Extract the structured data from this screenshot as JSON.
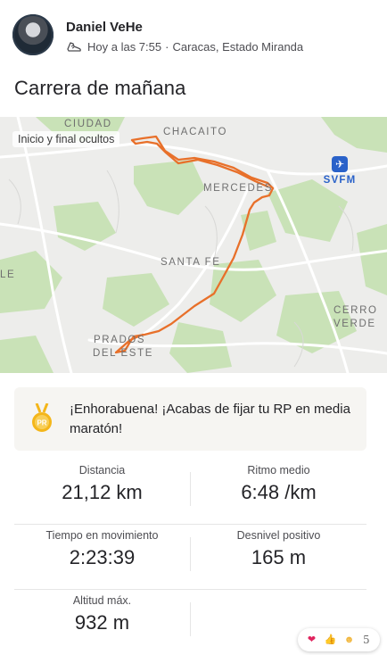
{
  "header": {
    "athlete_name": "Daniel VeHe",
    "timestamp": "Hoy a las 7:55",
    "separator": "·",
    "location": "Caracas, Estado Miranda",
    "activity_icon": "running-shoe-icon"
  },
  "activity": {
    "title": "Carrera de mañana"
  },
  "map": {
    "privacy_note": "Inicio y final ocultos",
    "labels": {
      "ciudad": "CIUDAD",
      "chacaito": "CHACAITO",
      "mercedes": "MERCEDES",
      "santa_fe": "SANTA FE",
      "cerro_verde_1": "CERRO",
      "cerro_verde_2": "VERDE",
      "prados_1": "PRADOS",
      "prados_2": "DEL ESTE",
      "left_edge": "LE"
    },
    "airport_code": "SVFM",
    "airport_icon": "airplane-icon",
    "route_color": "#e8702a",
    "park_color": "#c9e2b7"
  },
  "achievement": {
    "icon": "pr-medal-icon",
    "text": "¡Enhorabuena! ¡Acabas de fijar tu RP en media maratón!",
    "accent_color": "#f4b61a"
  },
  "stats": [
    {
      "label": "Distancia",
      "value": "21,12 km"
    },
    {
      "label": "Ritmo medio",
      "value": "6:48 /km"
    },
    {
      "label": "Tiempo en movimiento",
      "value": "2:23:39"
    },
    {
      "label": "Desnivel positivo",
      "value": "165 m"
    },
    {
      "label": "Altitud máx.",
      "value": "932 m"
    }
  ],
  "reactions": {
    "icons": [
      "heart-icon",
      "thumbs-up-icon",
      "care-icon"
    ],
    "count": "5"
  }
}
